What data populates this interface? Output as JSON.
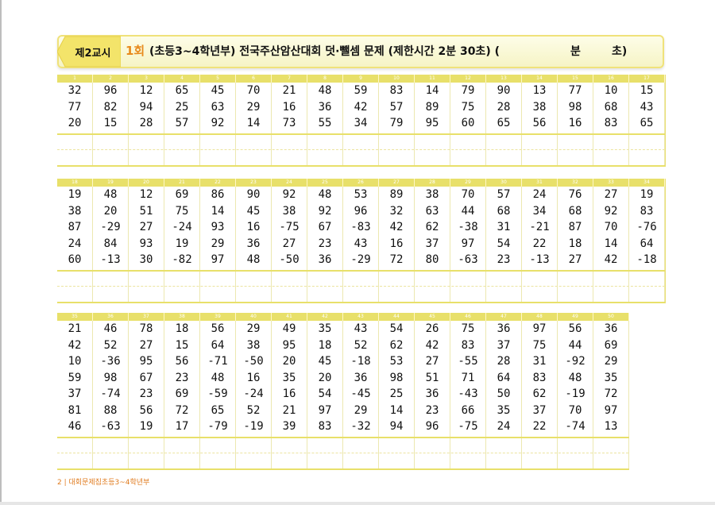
{
  "header": {
    "lesson": "제2교시",
    "round": "1회",
    "title": "(초등3~4학년부) 전국주산암산대회 덧·뺄셈 문제 (제한시간 2분 30초) (",
    "min_label": "분",
    "sec_label": "초)"
  },
  "blocks": [
    {
      "numbers": [
        "1",
        "2",
        "3",
        "4",
        "5",
        "6",
        "7",
        "8",
        "9",
        "10",
        "11",
        "12",
        "13",
        "14",
        "15",
        "16",
        "17"
      ],
      "columns": [
        [
          "32",
          "77",
          "20"
        ],
        [
          "96",
          "82",
          "15"
        ],
        [
          "12",
          "94",
          "28"
        ],
        [
          "65",
          "25",
          "57"
        ],
        [
          "45",
          "63",
          "92"
        ],
        [
          "70",
          "29",
          "14"
        ],
        [
          "21",
          "16",
          "73"
        ],
        [
          "48",
          "36",
          "55"
        ],
        [
          "59",
          "42",
          "34"
        ],
        [
          "83",
          "57",
          "79"
        ],
        [
          "14",
          "89",
          "95"
        ],
        [
          "79",
          "75",
          "60"
        ],
        [
          "90",
          "28",
          "65"
        ],
        [
          "13",
          "38",
          "56"
        ],
        [
          "77",
          "98",
          "16"
        ],
        [
          "10",
          "68",
          "83"
        ],
        [
          "15",
          "43",
          "65"
        ]
      ]
    },
    {
      "numbers": [
        "18",
        "19",
        "20",
        "21",
        "22",
        "23",
        "24",
        "25",
        "26",
        "27",
        "28",
        "29",
        "30",
        "31",
        "32",
        "33",
        "34"
      ],
      "columns": [
        [
          "19",
          "38",
          "87",
          "24",
          "60"
        ],
        [
          "48",
          "20",
          "-29",
          "84",
          "-13"
        ],
        [
          "12",
          "51",
          "27",
          "93",
          "30"
        ],
        [
          "69",
          "75",
          "-24",
          "19",
          "-82"
        ],
        [
          "86",
          "14",
          "93",
          "29",
          "97"
        ],
        [
          "90",
          "45",
          "16",
          "36",
          "48"
        ],
        [
          "92",
          "38",
          "-75",
          "27",
          "-50"
        ],
        [
          "48",
          "92",
          "67",
          "23",
          "36"
        ],
        [
          "53",
          "96",
          "-83",
          "43",
          "-29"
        ],
        [
          "89",
          "32",
          "42",
          "16",
          "72"
        ],
        [
          "38",
          "63",
          "62",
          "37",
          "80"
        ],
        [
          "70",
          "44",
          "-38",
          "97",
          "-63"
        ],
        [
          "57",
          "68",
          "31",
          "54",
          "23"
        ],
        [
          "24",
          "34",
          "-21",
          "22",
          "-13"
        ],
        [
          "76",
          "68",
          "87",
          "18",
          "27"
        ],
        [
          "27",
          "92",
          "70",
          "14",
          "42"
        ],
        [
          "19",
          "83",
          "-76",
          "64",
          "-18"
        ]
      ]
    },
    {
      "numbers": [
        "35",
        "36",
        "37",
        "38",
        "39",
        "40",
        "41",
        "42",
        "43",
        "44",
        "45",
        "46",
        "47",
        "48",
        "49",
        "50"
      ],
      "columns": [
        [
          "21",
          "42",
          "10",
          "59",
          "37",
          "81",
          "46"
        ],
        [
          "46",
          "52",
          "-36",
          "98",
          "-74",
          "88",
          "-63"
        ],
        [
          "78",
          "27",
          "95",
          "67",
          "23",
          "56",
          "19"
        ],
        [
          "18",
          "15",
          "56",
          "23",
          "69",
          "72",
          "17"
        ],
        [
          "56",
          "64",
          "-71",
          "48",
          "-59",
          "65",
          "-79"
        ],
        [
          "29",
          "38",
          "-50",
          "16",
          "-24",
          "52",
          "-19"
        ],
        [
          "49",
          "95",
          "20",
          "35",
          "16",
          "21",
          "39"
        ],
        [
          "35",
          "18",
          "45",
          "20",
          "54",
          "97",
          "83"
        ],
        [
          "43",
          "52",
          "-18",
          "36",
          "-45",
          "29",
          "-32"
        ],
        [
          "54",
          "62",
          "53",
          "98",
          "25",
          "14",
          "94"
        ],
        [
          "26",
          "42",
          "27",
          "51",
          "36",
          "23",
          "96"
        ],
        [
          "75",
          "83",
          "-55",
          "71",
          "-43",
          "66",
          "-75"
        ],
        [
          "36",
          "37",
          "28",
          "64",
          "50",
          "35",
          "24"
        ],
        [
          "97",
          "75",
          "31",
          "83",
          "62",
          "37",
          "22"
        ],
        [
          "56",
          "44",
          "-92",
          "48",
          "-19",
          "70",
          "-74"
        ],
        [
          "36",
          "69",
          "29",
          "35",
          "72",
          "97",
          "13"
        ]
      ]
    }
  ],
  "footer": {
    "page": "2",
    "text": "대회문제집초등3~4학년부"
  },
  "colors": {
    "accent_yellow": "#e8e06a",
    "round_orange": "#e88b1e",
    "footer_orange": "#e07b1e"
  }
}
